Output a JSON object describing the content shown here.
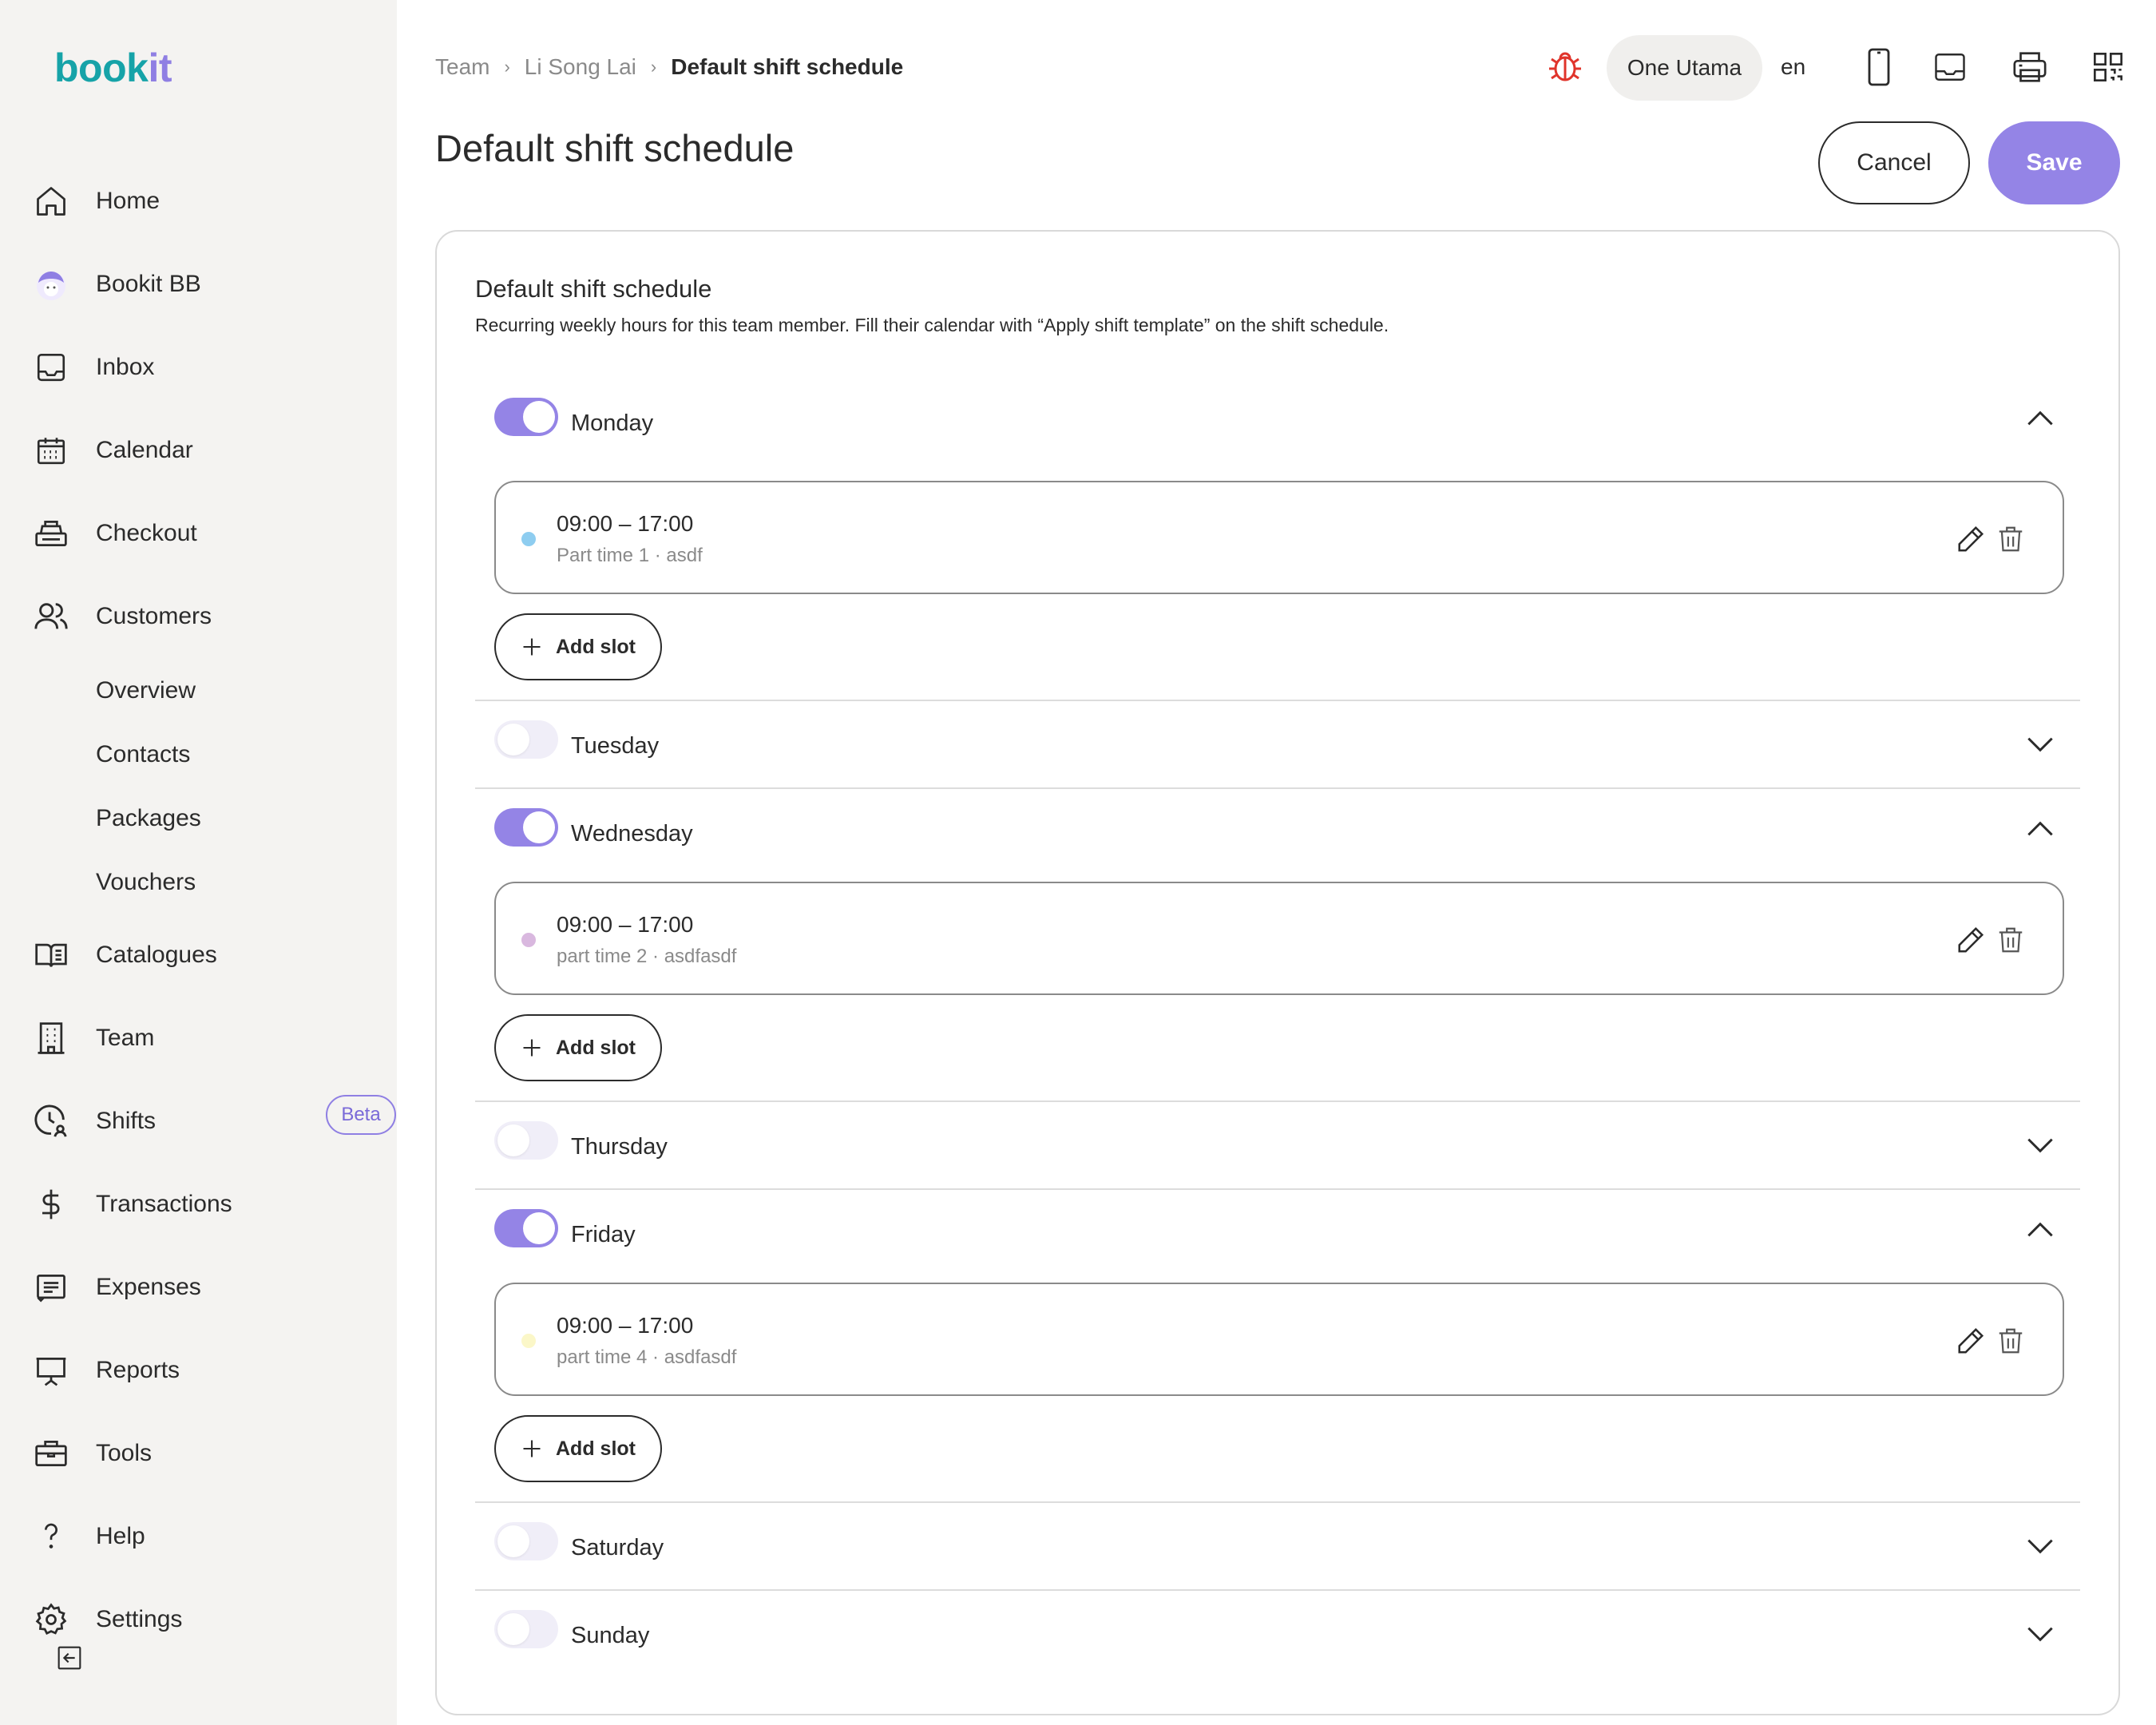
{
  "app": {
    "logo_part1": "book",
    "logo_part2": "it",
    "brand_color": "#16a3a8",
    "accent_color": "#9484e6"
  },
  "sidebar": {
    "items": [
      {
        "label": "Home",
        "icon": "home-icon"
      },
      {
        "label": "Bookit BB",
        "icon": "avatar-icon"
      },
      {
        "label": "Inbox",
        "icon": "inbox-icon"
      },
      {
        "label": "Calendar",
        "icon": "calendar-icon"
      },
      {
        "label": "Checkout",
        "icon": "register-icon"
      },
      {
        "label": "Customers",
        "icon": "users-icon"
      },
      {
        "label": "Catalogues",
        "icon": "book-icon"
      },
      {
        "label": "Team",
        "icon": "building-icon"
      },
      {
        "label": "Shifts",
        "icon": "clock-user-icon",
        "badge": "Beta"
      },
      {
        "label": "Transactions",
        "icon": "dollar-icon"
      },
      {
        "label": "Expenses",
        "icon": "receipt-icon"
      },
      {
        "label": "Reports",
        "icon": "presentation-icon"
      },
      {
        "label": "Tools",
        "icon": "briefcase-icon"
      },
      {
        "label": "Help",
        "icon": "question-icon"
      },
      {
        "label": "Settings",
        "icon": "gear-icon"
      }
    ],
    "customers_sub": [
      "Overview",
      "Contacts",
      "Packages",
      "Vouchers"
    ]
  },
  "header": {
    "breadcrumb": [
      "Team",
      "Li Song Lai",
      "Default shift schedule"
    ],
    "title": "Default shift schedule",
    "location": "One Utama",
    "language": "en",
    "cancel_label": "Cancel",
    "save_label": "Save"
  },
  "card": {
    "title": "Default shift schedule",
    "description": "Recurring weekly hours for this team member. Fill their calendar with “Apply shift template” on the shift schedule.",
    "add_slot_label": "Add slot",
    "days": [
      {
        "name": "Monday",
        "enabled": true,
        "expanded": true,
        "slots": [
          {
            "time": "09:00 – 17:00",
            "meta": "Part time 1 · asdf",
            "color": "#8ecdf0"
          }
        ]
      },
      {
        "name": "Tuesday",
        "enabled": false,
        "expanded": false,
        "slots": []
      },
      {
        "name": "Wednesday",
        "enabled": true,
        "expanded": true,
        "slots": [
          {
            "time": "09:00 – 17:00",
            "meta": "part time 2 · asdfasdf",
            "color": "#d9b8df"
          }
        ]
      },
      {
        "name": "Thursday",
        "enabled": false,
        "expanded": false,
        "slots": []
      },
      {
        "name": "Friday",
        "enabled": true,
        "expanded": true,
        "slots": [
          {
            "time": "09:00 – 17:00",
            "meta": "part time 4 · asdfasdf",
            "color": "#fbf7c8"
          }
        ]
      },
      {
        "name": "Saturday",
        "enabled": false,
        "expanded": false,
        "slots": []
      },
      {
        "name": "Sunday",
        "enabled": false,
        "expanded": false,
        "slots": []
      }
    ]
  }
}
